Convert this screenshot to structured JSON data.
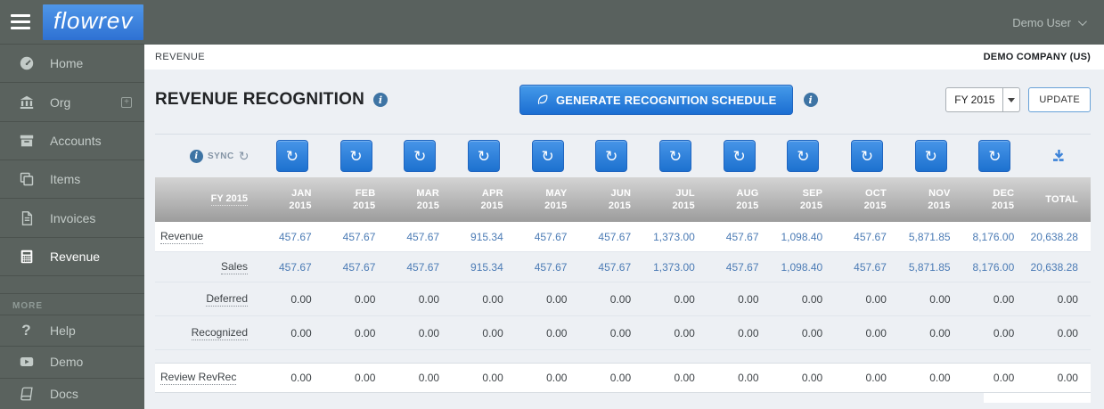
{
  "colors": {
    "accent_blue": "#2e76d3",
    "link_blue": "#4b7bb5",
    "sidebar_bg": "#5a625e",
    "table_header_gray": "#a8a8a8"
  },
  "topbar": {
    "user": "Demo User"
  },
  "sidebar": {
    "logo": "flowrev",
    "items": [
      {
        "label": "Home",
        "icon": "dashboard-icon"
      },
      {
        "label": "Org",
        "icon": "bank-icon"
      },
      {
        "label": "Accounts",
        "icon": "archive-icon"
      },
      {
        "label": "Items",
        "icon": "copy-icon"
      },
      {
        "label": "Invoices",
        "icon": "invoice-icon"
      },
      {
        "label": "Revenue",
        "icon": "calculator-icon",
        "active": true
      }
    ],
    "more_label": "MORE",
    "more_items": [
      {
        "label": "Help",
        "icon": "question-icon"
      },
      {
        "label": "Demo",
        "icon": "play-icon"
      },
      {
        "label": "Docs",
        "icon": "book-icon"
      }
    ]
  },
  "breadcrumb": {
    "section": "REVENUE",
    "company": "DEMO COMPANY (US)"
  },
  "page_header": {
    "title": "REVENUE RECOGNITION",
    "generate_button_label": "GENERATE RECOGNITION SCHEDULE",
    "year_select_value": "FY 2015",
    "update_button_label": "UPDATE"
  },
  "sync": {
    "label": "SYNC"
  },
  "table": {
    "first_col_header": "FY 2015",
    "months": [
      {
        "month": "JAN",
        "year": "2015"
      },
      {
        "month": "FEB",
        "year": "2015"
      },
      {
        "month": "MAR",
        "year": "2015"
      },
      {
        "month": "APR",
        "year": "2015"
      },
      {
        "month": "MAY",
        "year": "2015"
      },
      {
        "month": "JUN",
        "year": "2015"
      },
      {
        "month": "JUL",
        "year": "2015"
      },
      {
        "month": "AUG",
        "year": "2015"
      },
      {
        "month": "SEP",
        "year": "2015"
      },
      {
        "month": "OCT",
        "year": "2015"
      },
      {
        "month": "NOV",
        "year": "2015"
      },
      {
        "month": "DEC",
        "year": "2015"
      }
    ],
    "total_header": "TOTAL",
    "rows": [
      {
        "label": "Revenue",
        "label_align": "left",
        "value_style": "link",
        "values": [
          "457.67",
          "457.67",
          "457.67",
          "915.34",
          "457.67",
          "457.67",
          "1,373.00",
          "457.67",
          "1,098.40",
          "457.67",
          "5,871.85",
          "8,176.00"
        ],
        "total": "20,638.28"
      },
      {
        "label": "Sales",
        "label_align": "right",
        "value_style": "link",
        "values": [
          "457.67",
          "457.67",
          "457.67",
          "915.34",
          "457.67",
          "457.67",
          "1,373.00",
          "457.67",
          "1,098.40",
          "457.67",
          "5,871.85",
          "8,176.00"
        ],
        "total": "20,638.28"
      },
      {
        "label": "Deferred",
        "label_align": "right",
        "value_style": "plain",
        "values": [
          "0.00",
          "0.00",
          "0.00",
          "0.00",
          "0.00",
          "0.00",
          "0.00",
          "0.00",
          "0.00",
          "0.00",
          "0.00",
          "0.00"
        ],
        "total": "0.00"
      },
      {
        "label": "Recognized",
        "label_align": "right",
        "value_style": "plain",
        "values": [
          "0.00",
          "0.00",
          "0.00",
          "0.00",
          "0.00",
          "0.00",
          "0.00",
          "0.00",
          "0.00",
          "0.00",
          "0.00",
          "0.00"
        ],
        "total": "0.00"
      }
    ],
    "footer_row": {
      "label": "Review RevRec",
      "label_align": "left",
      "value_style": "plain",
      "values": [
        "0.00",
        "0.00",
        "0.00",
        "0.00",
        "0.00",
        "0.00",
        "0.00",
        "0.00",
        "0.00",
        "0.00",
        "0.00",
        "0.00"
      ],
      "total": "0.00"
    }
  }
}
